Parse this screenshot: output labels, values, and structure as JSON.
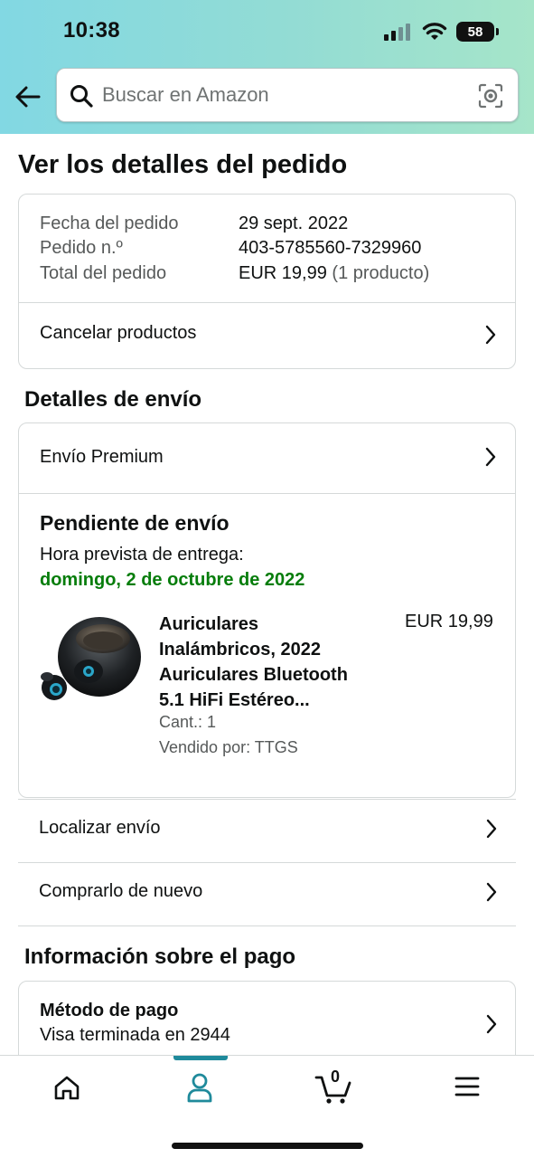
{
  "status_bar": {
    "time": "10:38",
    "battery": "58"
  },
  "search": {
    "placeholder": "Buscar en Amazon",
    "value": ""
  },
  "page": {
    "title": "Ver los detalles del pedido"
  },
  "order_summary": {
    "date_label": "Fecha del pedido",
    "date_value": "29 sept. 2022",
    "number_label": "Pedido n.º",
    "number_value": "403-5785560-7329960",
    "total_label": "Total del pedido",
    "total_value": "EUR 19,99",
    "total_count": "(1 producto)",
    "cancel_label": "Cancelar productos"
  },
  "shipping": {
    "section_title": "Detalles de envío",
    "method": "Envío Premium",
    "status": "Pendiente de envío",
    "delivery_label": "Hora prevista de entrega:",
    "delivery_date": "domingo, 2 de octubre de 2022",
    "product": {
      "title_line1": "Auriculares",
      "title_line2": "Inalámbricos, 2022",
      "title_line3": "Auriculares Bluetooth",
      "title_line4": "5.1 HiFi Estéreo...",
      "price": "EUR 19,99",
      "quantity": "Cant.: 1",
      "seller": "Vendido por: TTGS"
    }
  },
  "actions": {
    "track": "Localizar envío",
    "buy_again": "Comprarlo de nuevo"
  },
  "payment": {
    "section_title": "Información sobre el pago",
    "method_label": "Método de pago",
    "method_value": "Visa terminada en 2944"
  },
  "bottom_nav": {
    "items": [
      "home-icon",
      "account-icon",
      "cart-icon",
      "menu-icon"
    ],
    "cart_count": "0",
    "active_color": "#1f8a9b"
  },
  "colors": {
    "accent": "#1f8a9b",
    "delivery_green": "#067d0b",
    "header_gradient_start": "#82d8e3",
    "header_gradient_end": "#a6e5c9"
  }
}
